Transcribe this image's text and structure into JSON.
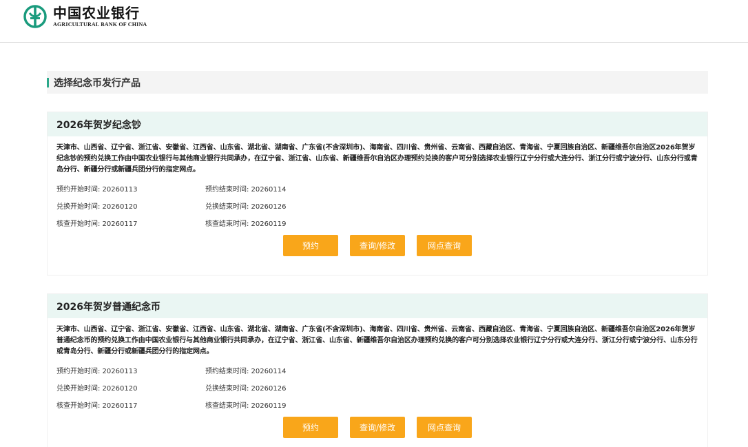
{
  "header": {
    "logo_cn": "中国农业银行",
    "logo_en": "AGRICULTURAL BANK OF CHINA",
    "brand_color": "#1a9b7d"
  },
  "section": {
    "title": "选择纪念币发行产品"
  },
  "products": [
    {
      "title": "2026年贺岁纪念钞",
      "description": "天津市、山西省、辽宁省、浙江省、安徽省、江西省、山东省、湖北省、湖南省、广东省(不含深圳市)、海南省、四川省、贵州省、云南省、西藏自治区、青海省、宁夏回族自治区、新疆维吾尔自治区2026年贺岁纪念钞的预约兑换工作由中国农业银行与其他商业银行共同承办，在辽宁省、浙江省、山东省、新疆维吾尔自治区办理预约兑换的客户可分别选择农业银行辽宁分行或大连分行、浙江分行或宁波分行、山东分行或青岛分行、新疆分行或新疆兵团分行的指定网点。",
      "reserve_start": "预约开始时间: 20260113",
      "reserve_end": "预约结束时间: 20260114",
      "exchange_start": "兑换开始时间: 20260120",
      "exchange_end": "兑换结束时间: 20260126",
      "verify_start": "核查开始时间: 20260117",
      "verify_end": "核查结束时间: 20260119",
      "buttons": {
        "reserve": "预约",
        "query": "查询/修改",
        "branch": "网点查询"
      }
    },
    {
      "title": "2026年贺岁普通纪念币",
      "description": "天津市、山西省、辽宁省、浙江省、安徽省、江西省、山东省、湖北省、湖南省、广东省(不含深圳市)、海南省、四川省、贵州省、云南省、西藏自治区、青海省、宁夏回族自治区、新疆维吾尔自治区2026年贺岁普通纪念币的预约兑换工作由中国农业银行与其他商业银行共同承办，在辽宁省、浙江省、山东省、新疆维吾尔自治区办理预约兑换的客户可分别选择农业银行辽宁分行或大连分行、浙江分行或宁波分行、山东分行或青岛分行、新疆分行或新疆兵团分行的指定网点。",
      "reserve_start": "预约开始时间: 20260113",
      "reserve_end": "预约结束时间: 20260114",
      "exchange_start": "兑换开始时间: 20260120",
      "exchange_end": "兑换结束时间: 20260126",
      "verify_start": "核查开始时间: 20260117",
      "verify_end": "核查结束时间: 20260119",
      "buttons": {
        "reserve": "预约",
        "query": "查询/修改",
        "branch": "网点查询"
      }
    }
  ]
}
